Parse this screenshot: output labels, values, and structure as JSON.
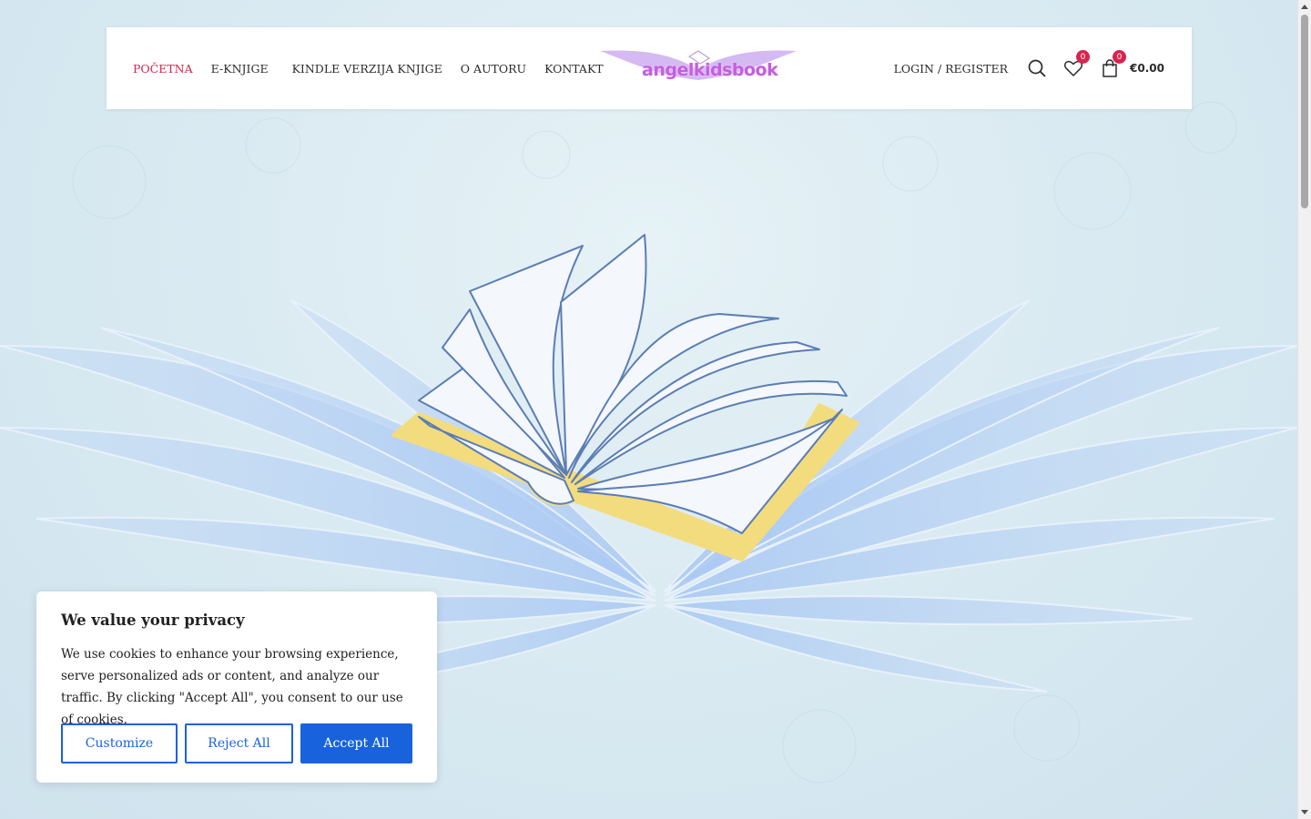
{
  "nav": {
    "items": [
      {
        "label": "POČETNA",
        "active": true
      },
      {
        "label": "E-KNJIGE",
        "active": false
      },
      {
        "label": "KINDLE VERZIJA KNJIGE",
        "active": false
      },
      {
        "label": "O AUTORU",
        "active": false
      },
      {
        "label": "KONTAKT",
        "active": false
      }
    ]
  },
  "logo": {
    "text": "angelkidsbook"
  },
  "tools": {
    "login_label": "LOGIN / REGISTER",
    "search_icon": "search-icon",
    "wishlist_icon": "heart-icon",
    "wishlist_count": "0",
    "cart_icon": "shopping-bag-icon",
    "cart_count": "0",
    "cart_total": "€0.00"
  },
  "cookie": {
    "title": "We value your privacy",
    "body": "We use cookies to enhance your browsing experience, serve personalized ads or content, and analyze our traffic. By clicking \"Accept All\", you consent to our use of cookies.",
    "customize_label": "Customize",
    "reject_label": "Reject All",
    "accept_label": "Accept All"
  },
  "colors": {
    "accent": "#d6254f",
    "cookie_button": "#1863dc",
    "logo": "#c45fe0",
    "wings": "#b9d3f5",
    "book_cover": "#f3dc7e",
    "book_lines": "#5b7db5"
  }
}
